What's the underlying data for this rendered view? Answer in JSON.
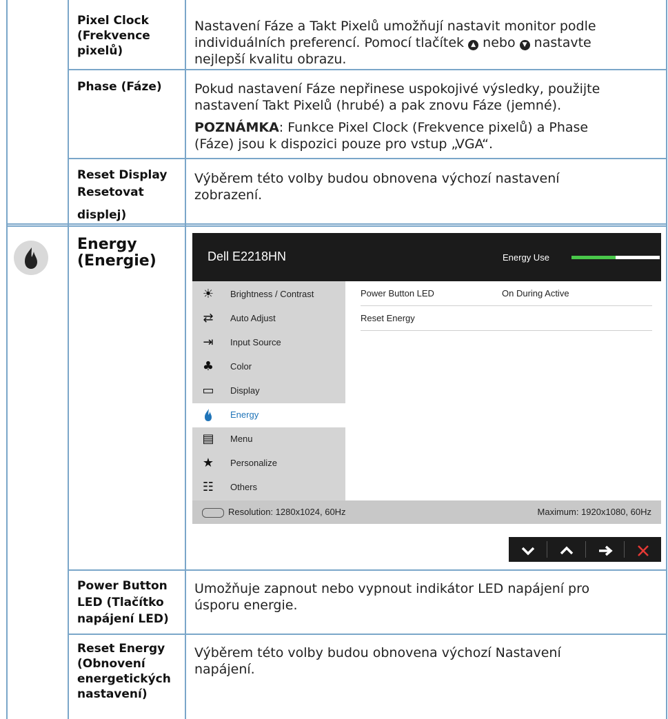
{
  "rows": {
    "pixel_clock": {
      "label_lines": [
        "Pixel Clock",
        "(Frekvence",
        "pixelů)"
      ],
      "desc_lines": [
        "Nastavení Fáze a Takt Pixelů umožňují nastavit monitor podle",
        "individuálních preferencí. Pomocí tlačítek",
        "nebo",
        "nastavte",
        "nejlepší kvalitu obrazu."
      ]
    },
    "phase": {
      "label": "Phase (Fáze)",
      "desc_lines": [
        "Pokud nastavení Fáze nepřinese uspokojivé výsledky, použijte",
        "nastavení Takt Pixelů (hrubé) a pak znovu Fáze (jemné)."
      ],
      "note_bold": "POZNÁMKA",
      "note_lines": [
        ": Funkce Pixel Clock (Frekvence pixelů) a Phase",
        "(Fáze) jsou k dispozici pouze pro vstup „VGA“."
      ]
    },
    "reset_display": {
      "label_lines": [
        "Reset Display",
        "Resetovat",
        "displej)"
      ],
      "desc_lines": [
        "Výběrem této volby budou obnovena výchozí nastavení",
        "zobrazení."
      ]
    },
    "energy": {
      "label_lines": [
        "Energy",
        "(Energie)"
      ]
    },
    "power_button_led": {
      "label_lines": [
        "Power Button",
        "LED (Tlačítko",
        "napájení LED)"
      ],
      "desc_lines": [
        "Umožňuje zapnout nebo vypnout indikátor LED napájení pro",
        "úsporu energie."
      ]
    },
    "reset_energy": {
      "label_lines": [
        "Reset Energy",
        "(Obnovení",
        "energetických",
        "nastavení)"
      ],
      "desc_lines": [
        "Výběrem této volby budou obnovena výchozí Nastavení",
        "napájení."
      ]
    }
  },
  "osd": {
    "title": "Dell E2218HN",
    "energy_use_label": "Energy Use",
    "energy_use_level": 0.5,
    "menu": [
      {
        "label": "Brightness / Contrast",
        "icon": "sun-icon"
      },
      {
        "label": "Auto Adjust",
        "icon": "auto-adjust-icon"
      },
      {
        "label": "Input Source",
        "icon": "input-source-icon"
      },
      {
        "label": "Color",
        "icon": "color-icon"
      },
      {
        "label": "Display",
        "icon": "display-icon"
      },
      {
        "label": "Energy",
        "icon": "energy-icon"
      },
      {
        "label": "Menu",
        "icon": "menu-icon"
      },
      {
        "label": "Personalize",
        "icon": "star-icon"
      },
      {
        "label": "Others",
        "icon": "others-icon"
      }
    ],
    "active_menu": "Energy",
    "options": [
      {
        "label": "Power Button LED",
        "value": "On During Active"
      },
      {
        "label": "Reset Energy",
        "value": ""
      }
    ],
    "status_left": "Resolution: 1280x1024, 60Hz",
    "status_right": "Maximum: 1920x1080, 60Hz",
    "nav": [
      "chevron-down-icon",
      "chevron-up-icon",
      "arrow-right-icon",
      "close-icon"
    ]
  },
  "colors": {
    "table_line": "#7aa6c9",
    "osd_header": "#1b1b1b",
    "energy_bar": "#49c74a",
    "active_menu_text": "#1f74b8",
    "close_x": "#e53935"
  }
}
